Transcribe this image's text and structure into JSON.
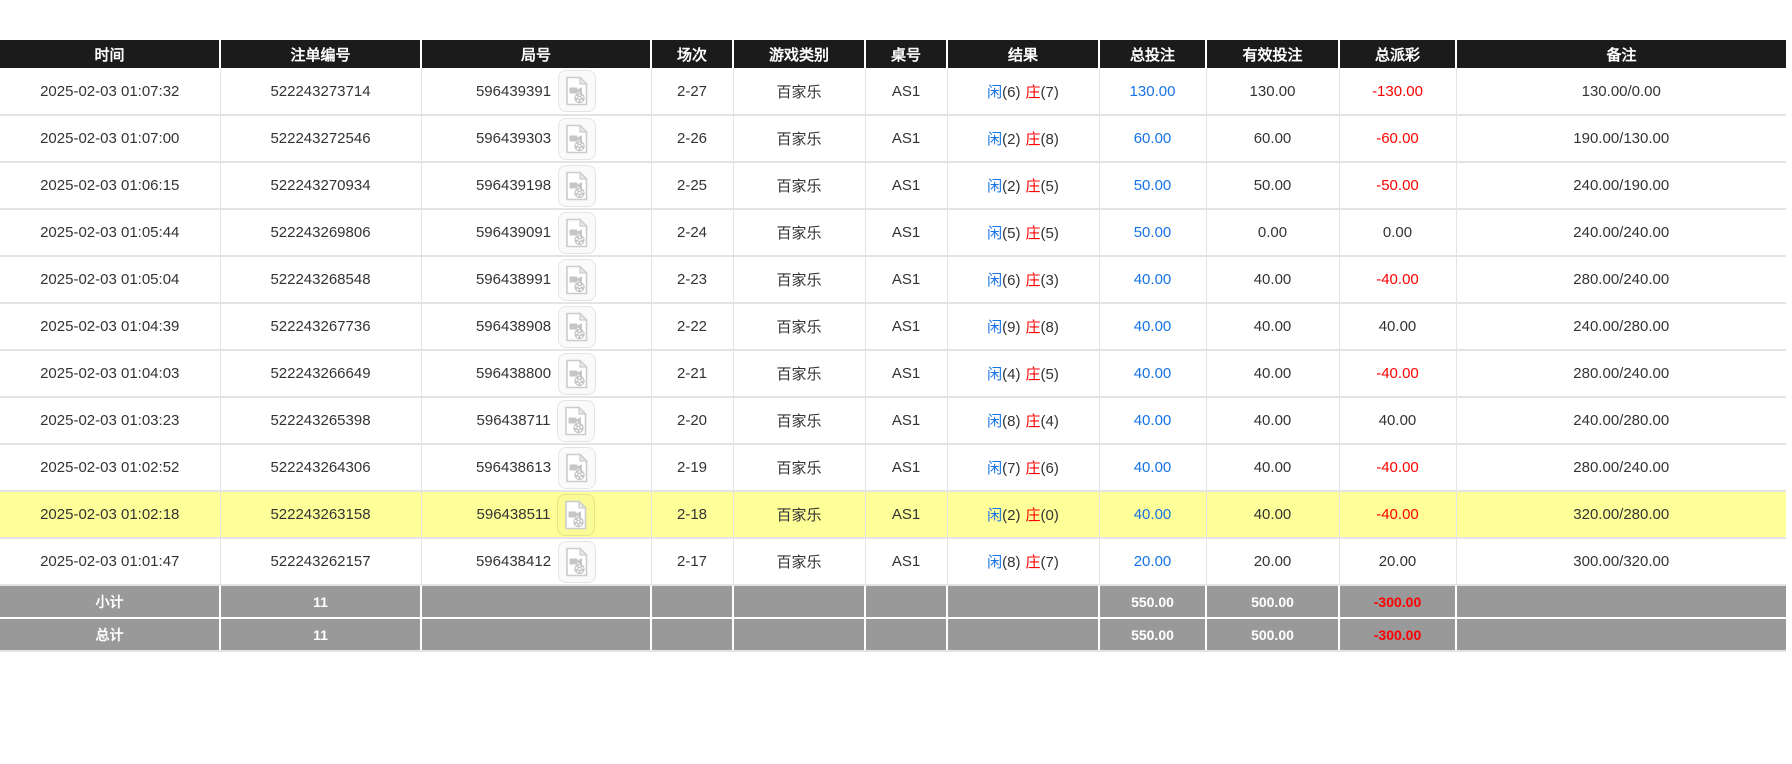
{
  "colors": {
    "header_bg": "#1b1b1b",
    "footer_bg": "#999999",
    "accent_blue": "#1673e6",
    "loss_red": "#ff0000",
    "highlight_yellow": "#ffff99"
  },
  "labels": {
    "player": "闲",
    "banker": "庄"
  },
  "icons": {
    "round_video": "video-file-icon"
  },
  "table": {
    "columns": [
      {
        "key": "time",
        "label": "时间"
      },
      {
        "key": "bet_id",
        "label": "注单编号"
      },
      {
        "key": "round_no",
        "label": "局号"
      },
      {
        "key": "session",
        "label": "场次"
      },
      {
        "key": "game_type",
        "label": "游戏类别"
      },
      {
        "key": "table_no",
        "label": "桌号"
      },
      {
        "key": "result",
        "label": "结果"
      },
      {
        "key": "total_bet",
        "label": "总投注"
      },
      {
        "key": "valid_bet",
        "label": "有效投注"
      },
      {
        "key": "total_payout",
        "label": "总派彩"
      },
      {
        "key": "remark",
        "label": "备注"
      }
    ],
    "rows": [
      {
        "time": "2025-02-03 01:07:32",
        "bet_id": "522243273714",
        "round_no": "596439391",
        "session": "2-27",
        "game_type": "百家乐",
        "table_no": "AS1",
        "player_score": "6",
        "banker_score": "7",
        "total_bet": "130.00",
        "valid_bet": "130.00",
        "total_payout": "-130.00",
        "remark": "130.00/0.00",
        "highlight": false
      },
      {
        "time": "2025-02-03 01:07:00",
        "bet_id": "522243272546",
        "round_no": "596439303",
        "session": "2-26",
        "game_type": "百家乐",
        "table_no": "AS1",
        "player_score": "2",
        "banker_score": "8",
        "total_bet": "60.00",
        "valid_bet": "60.00",
        "total_payout": "-60.00",
        "remark": "190.00/130.00",
        "highlight": false
      },
      {
        "time": "2025-02-03 01:06:15",
        "bet_id": "522243270934",
        "round_no": "596439198",
        "session": "2-25",
        "game_type": "百家乐",
        "table_no": "AS1",
        "player_score": "2",
        "banker_score": "5",
        "total_bet": "50.00",
        "valid_bet": "50.00",
        "total_payout": "-50.00",
        "remark": "240.00/190.00",
        "highlight": false
      },
      {
        "time": "2025-02-03 01:05:44",
        "bet_id": "522243269806",
        "round_no": "596439091",
        "session": "2-24",
        "game_type": "百家乐",
        "table_no": "AS1",
        "player_score": "5",
        "banker_score": "5",
        "total_bet": "50.00",
        "valid_bet": "0.00",
        "total_payout": "0.00",
        "remark": "240.00/240.00",
        "highlight": false
      },
      {
        "time": "2025-02-03 01:05:04",
        "bet_id": "522243268548",
        "round_no": "596438991",
        "session": "2-23",
        "game_type": "百家乐",
        "table_no": "AS1",
        "player_score": "6",
        "banker_score": "3",
        "total_bet": "40.00",
        "valid_bet": "40.00",
        "total_payout": "-40.00",
        "remark": "280.00/240.00",
        "highlight": false
      },
      {
        "time": "2025-02-03 01:04:39",
        "bet_id": "522243267736",
        "round_no": "596438908",
        "session": "2-22",
        "game_type": "百家乐",
        "table_no": "AS1",
        "player_score": "9",
        "banker_score": "8",
        "total_bet": "40.00",
        "valid_bet": "40.00",
        "total_payout": "40.00",
        "remark": "240.00/280.00",
        "highlight": false
      },
      {
        "time": "2025-02-03 01:04:03",
        "bet_id": "522243266649",
        "round_no": "596438800",
        "session": "2-21",
        "game_type": "百家乐",
        "table_no": "AS1",
        "player_score": "4",
        "banker_score": "5",
        "total_bet": "40.00",
        "valid_bet": "40.00",
        "total_payout": "-40.00",
        "remark": "280.00/240.00",
        "highlight": false
      },
      {
        "time": "2025-02-03 01:03:23",
        "bet_id": "522243265398",
        "round_no": "596438711",
        "session": "2-20",
        "game_type": "百家乐",
        "table_no": "AS1",
        "player_score": "8",
        "banker_score": "4",
        "total_bet": "40.00",
        "valid_bet": "40.00",
        "total_payout": "40.00",
        "remark": "240.00/280.00",
        "highlight": false
      },
      {
        "time": "2025-02-03 01:02:52",
        "bet_id": "522243264306",
        "round_no": "596438613",
        "session": "2-19",
        "game_type": "百家乐",
        "table_no": "AS1",
        "player_score": "7",
        "banker_score": "6",
        "total_bet": "40.00",
        "valid_bet": "40.00",
        "total_payout": "-40.00",
        "remark": "280.00/240.00",
        "highlight": false
      },
      {
        "time": "2025-02-03 01:02:18",
        "bet_id": "522243263158",
        "round_no": "596438511",
        "session": "2-18",
        "game_type": "百家乐",
        "table_no": "AS1",
        "player_score": "2",
        "banker_score": "0",
        "total_bet": "40.00",
        "valid_bet": "40.00",
        "total_payout": "-40.00",
        "remark": "320.00/280.00",
        "highlight": true
      },
      {
        "time": "2025-02-03 01:01:47",
        "bet_id": "522243262157",
        "round_no": "596438412",
        "session": "2-17",
        "game_type": "百家乐",
        "table_no": "AS1",
        "player_score": "8",
        "banker_score": "7",
        "total_bet": "20.00",
        "valid_bet": "20.00",
        "total_payout": "20.00",
        "remark": "300.00/320.00",
        "highlight": false
      }
    ],
    "footer": [
      {
        "label": "小计",
        "count": "11",
        "total_bet": "550.00",
        "valid_bet": "500.00",
        "total_payout": "-300.00"
      },
      {
        "label": "总计",
        "count": "11",
        "total_bet": "550.00",
        "valid_bet": "500.00",
        "total_payout": "-300.00"
      }
    ]
  }
}
